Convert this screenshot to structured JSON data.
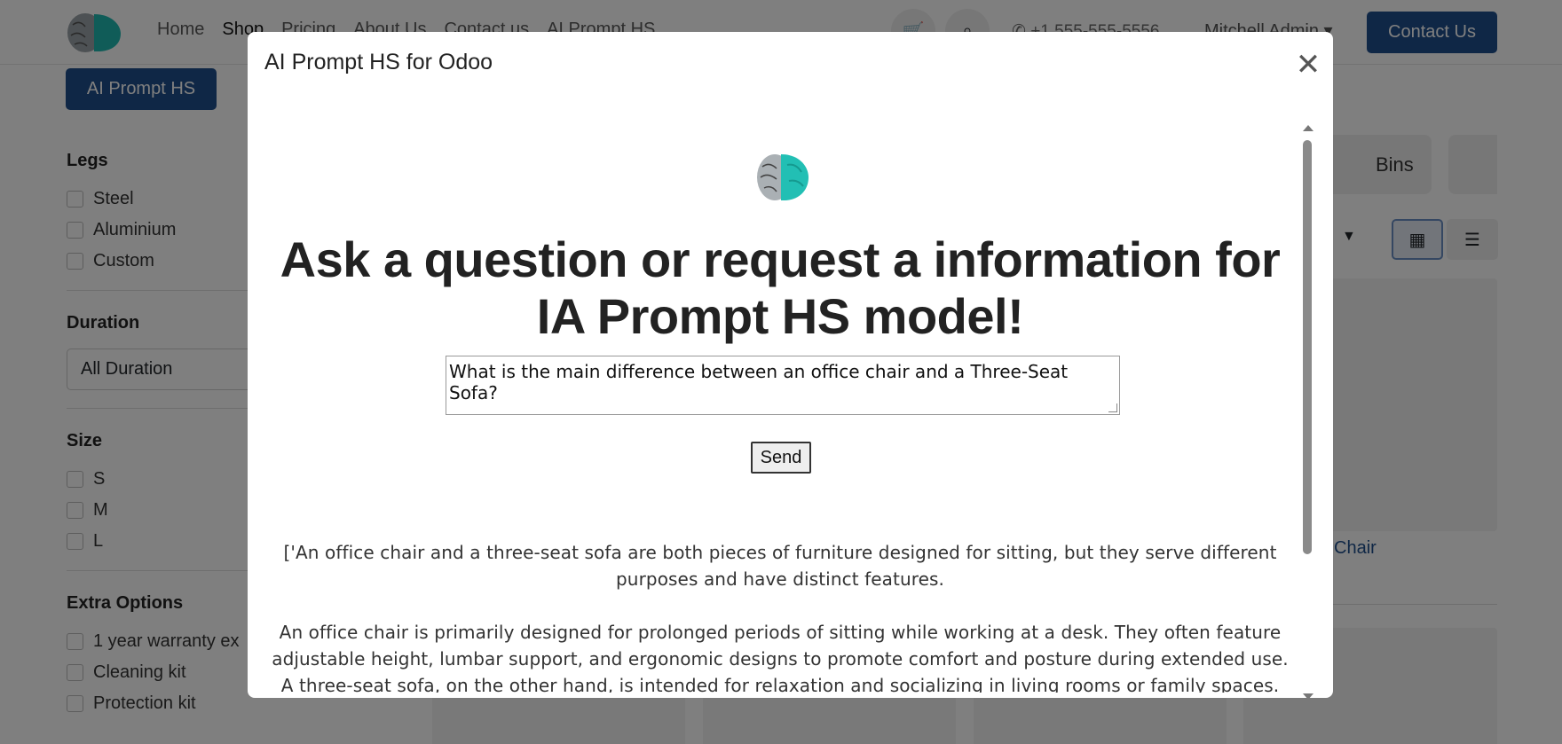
{
  "nav": {
    "links": [
      "Home",
      "Shop",
      "Pricing",
      "About Us",
      "Contact us",
      "AI Prompt HS"
    ],
    "phone": "+1 555-555-5556",
    "user": "Mitchell Admin",
    "contact_button": "Contact Us"
  },
  "page": {
    "ai_button": "AI Prompt HS",
    "filters": {
      "legs_title": "Legs",
      "legs": [
        "Steel",
        "Aluminium",
        "Custom"
      ],
      "duration_title": "Duration",
      "duration_value": "All Duration",
      "size_title": "Size",
      "sizes": [
        "S",
        "M",
        "L"
      ],
      "extra_title": "Extra Options",
      "extras": [
        "1 year warranty ex",
        "Cleaning kit",
        "Protection kit"
      ]
    },
    "category_label": "Bins",
    "product_name": "Chair"
  },
  "modal": {
    "title": "AI Prompt HS for Odoo",
    "headline": "Ask a question or request a information for IA Prompt HS model!",
    "prompt_value": "What is the main difference between an office chair and a Three-Seat Sofa?",
    "send_label": "Send",
    "answer_paragraphs": [
      "['An office chair and a three-seat sofa are both pieces of furniture designed for sitting, but they serve different purposes and have distinct features.",
      "An office chair is primarily designed for prolonged periods of sitting while working at a desk. They often feature adjustable height, lumbar support, and ergonomic designs to promote comfort and posture during extended use. A three-seat sofa, on the other hand, is intended for relaxation and socializing in living rooms or family spaces."
    ]
  },
  "colors": {
    "brand_blue": "#1f4f8c",
    "backdrop": "rgba(0,0,0,0.5)"
  }
}
